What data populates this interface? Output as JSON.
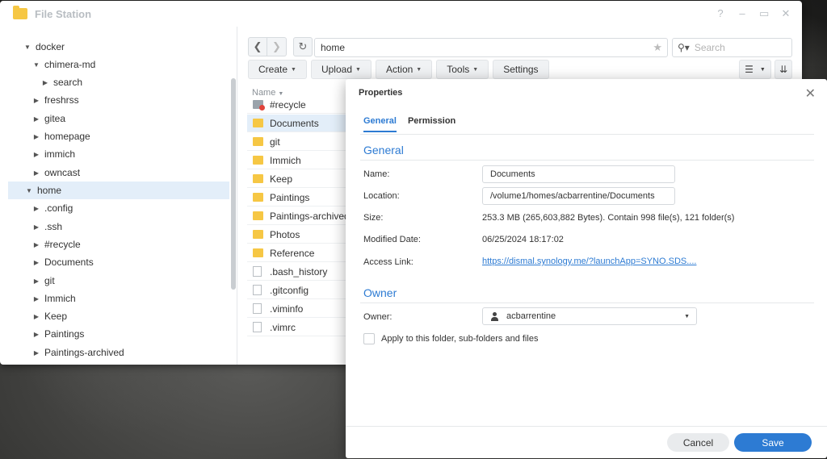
{
  "window": {
    "title": "File Station",
    "controls": [
      "?",
      "–",
      "▭",
      "✕"
    ]
  },
  "tree": [
    {
      "label": "docker",
      "expanded": true
    },
    {
      "label": "chimera-md",
      "expanded": true
    },
    {
      "label": "search",
      "expanded": false
    },
    {
      "label": "freshrss",
      "expanded": false
    },
    {
      "label": "gitea",
      "expanded": false
    },
    {
      "label": "homepage",
      "expanded": false
    },
    {
      "label": "immich",
      "expanded": false
    },
    {
      "label": "owncast",
      "expanded": false
    },
    {
      "label": "home",
      "expanded": true,
      "selected": true
    },
    {
      "label": ".config",
      "expanded": false
    },
    {
      "label": ".ssh",
      "expanded": false
    },
    {
      "label": "#recycle",
      "expanded": false
    },
    {
      "label": "Documents",
      "expanded": false
    },
    {
      "label": "git",
      "expanded": false
    },
    {
      "label": "Immich",
      "expanded": false
    },
    {
      "label": "Keep",
      "expanded": false
    },
    {
      "label": "Paintings",
      "expanded": false
    },
    {
      "label": "Paintings-archived",
      "expanded": false
    }
  ],
  "path": {
    "value": "home"
  },
  "search": {
    "placeholder": "Search"
  },
  "toolbar": {
    "create": "Create",
    "upload": "Upload",
    "action": "Action",
    "tools": "Tools",
    "settings": "Settings"
  },
  "list": {
    "column_name": "Name",
    "files": [
      {
        "name": "#recycle",
        "type": "recycle"
      },
      {
        "name": "Documents",
        "type": "folder",
        "selected": true
      },
      {
        "name": "git",
        "type": "folder"
      },
      {
        "name": "Immich",
        "type": "folder"
      },
      {
        "name": "Keep",
        "type": "folder"
      },
      {
        "name": "Paintings",
        "type": "folder"
      },
      {
        "name": "Paintings-archived",
        "type": "folder"
      },
      {
        "name": "Photos",
        "type": "folder"
      },
      {
        "name": "Reference",
        "type": "folder"
      },
      {
        "name": ".bash_history",
        "type": "file"
      },
      {
        "name": ".gitconfig",
        "type": "file"
      },
      {
        "name": ".viminfo",
        "type": "file"
      },
      {
        "name": ".vimrc",
        "type": "file"
      }
    ]
  },
  "dialog": {
    "title": "Properties",
    "tabs": {
      "general": "General",
      "permission": "Permission"
    },
    "general_section": "General",
    "name_label": "Name:",
    "name_value": "Documents",
    "location_label": "Location:",
    "location_value": "/volume1/homes/acbarrentine/Documents",
    "size_label": "Size:",
    "size_value": "253.3 MB (265,603,882 Bytes). Contain 998 file(s), 121 folder(s)",
    "modified_label": "Modified Date:",
    "modified_value": "06/25/2024 18:17:02",
    "access_label": "Access Link:",
    "access_value": "https://dismal.synology.me/?launchApp=SYNO.SDS....",
    "owner_section": "Owner",
    "owner_label": "Owner:",
    "owner_value": "acbarrentine",
    "apply_label": "Apply to this folder, sub-folders and files",
    "cancel": "Cancel",
    "save": "Save"
  },
  "colors": {
    "accent": "#2d7bd3",
    "folder": "#f6c744",
    "selection": "#e3eef9"
  }
}
